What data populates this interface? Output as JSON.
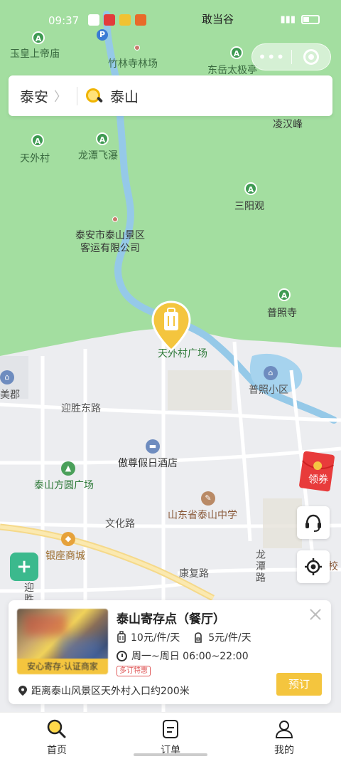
{
  "status_bar": {
    "time": "09:37",
    "carrier": "敢当谷"
  },
  "search": {
    "city": "泰安",
    "keyword": "泰山"
  },
  "map": {
    "labels": {
      "yuhuang": "玉皇上帝庙",
      "zhulin": "竹林寺林场",
      "dongyue": "东岳太极亭",
      "linghan": "凌汉峰",
      "tianwai": "天外村",
      "longtan": "龙潭飞瀑",
      "sanyang": "三阳观",
      "keyun": "泰安市泰山景区\n客运有限公司",
      "puzhao": "普照寺",
      "guangchang": "天外村广场",
      "meijun": "美郡",
      "puzhao_xq": "普照小区",
      "yingsheng": "迎胜东路",
      "aozun": "傲尊假日酒店",
      "fangyuan": "泰山方圆广场",
      "wenhua": "文化路",
      "zhongxue": "山东省泰山中学",
      "yinzuo": "银座商城",
      "longtan_rd": "龙\n潭\n路",
      "kangfu": "康复路",
      "yingsheng2": "迎\n胜",
      "xiao": "校"
    }
  },
  "coupon": {
    "label": "领券"
  },
  "card": {
    "store_name": "泰山寄存点（餐厅）",
    "certified_badge": "安心寄存·认证商家",
    "price_luggage": "10元/件/天",
    "price_bag": "5元/件/天",
    "hours": "周一~周日 06:00~22:00",
    "tag": "多订特惠",
    "distance": "距离泰山风景区天外村入口约200米",
    "book_label": "预订"
  },
  "tabs": [
    {
      "label": "首页",
      "icon": "search-icon"
    },
    {
      "label": "订单",
      "icon": "order-icon"
    },
    {
      "label": "我的",
      "icon": "profile-icon"
    }
  ],
  "colors": {
    "accent": "#f4c53e",
    "map_green": "#9ddc9a",
    "river": "#8fc6e8"
  }
}
